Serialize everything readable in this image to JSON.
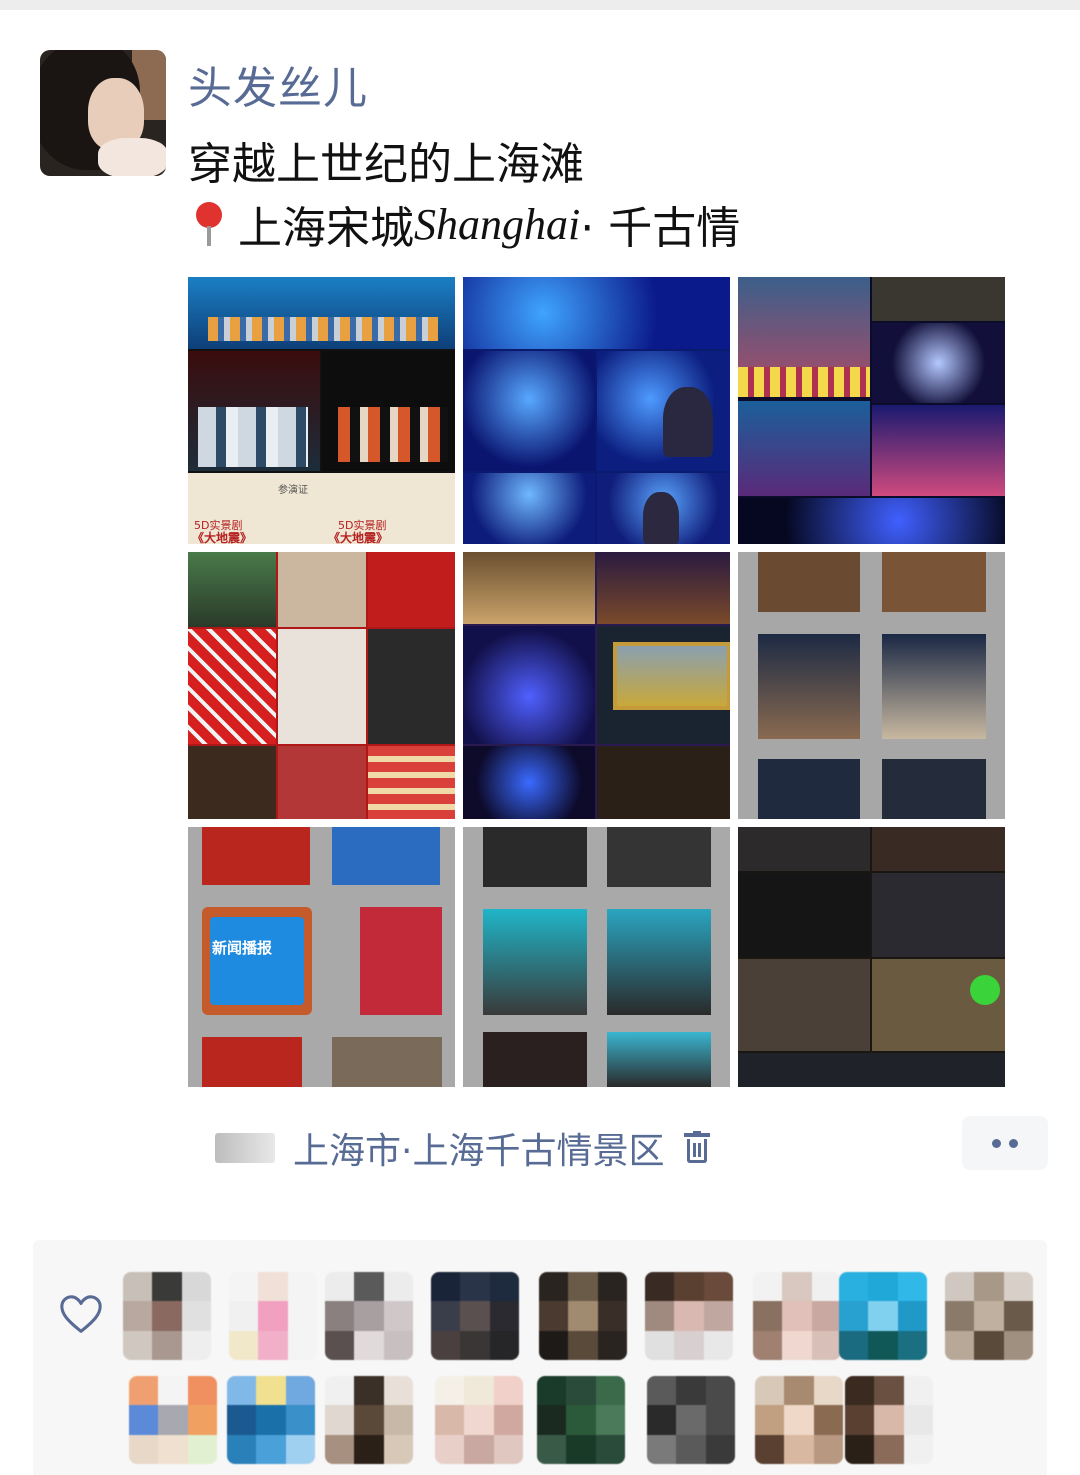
{
  "post": {
    "username": "头发丝儿",
    "caption": "穿越上世纪的上海滩",
    "location_tag": {
      "prefix": "上海宋城",
      "latin": "Shanghai",
      "suffix": " · 千古情"
    },
    "photo_count": 9,
    "location_footer": "上海市·上海千古情景区"
  },
  "photo_captions": {
    "tile1_line1": "5D实景剧",
    "tile1_line2": "《大地震》",
    "tile1_line3": "5D实景剧",
    "tile1_line4": "《大地震》",
    "tile1_card": "参演证",
    "tile7_tv": "新闻播报"
  },
  "likes": {
    "count_rows": 2,
    "avatars_row1": 9,
    "avatars_row2": 8
  },
  "icons": {
    "pin": "location-pin-icon",
    "trash": "trash-icon",
    "more": "more-dots-icon",
    "heart": "heart-outline-icon"
  },
  "colors": {
    "link": "#576b95",
    "text": "#111111",
    "panel": "#f7f7f7"
  }
}
